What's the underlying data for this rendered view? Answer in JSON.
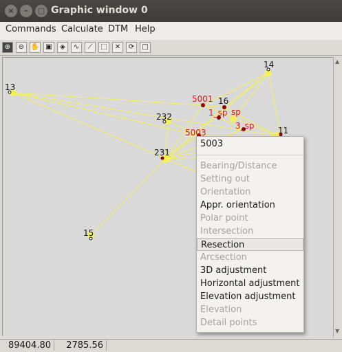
{
  "window": {
    "title": "Graphic window 0",
    "close": "×",
    "minimize": "–",
    "maximize": "□"
  },
  "menubar": [
    "Commands",
    "Calculate",
    "DTM",
    "Help"
  ],
  "toolbar": [
    "zoom-in-icon",
    "zoom-out-icon",
    "pan-hand-icon",
    "zoom-window-icon",
    "zoom-all-icon",
    "line-icon",
    "measure-icon",
    "select-icon",
    "cross-icon",
    "refresh-icon",
    "frame-icon"
  ],
  "points": {
    "p13": "13",
    "p14": "14",
    "p16": "16",
    "p5001": "5001",
    "p232": "232",
    "p1sp": "1_sp",
    "psp": "sp",
    "p3sp": "3_sp",
    "p5003": "5003",
    "p11": "11",
    "p231": "231",
    "p15": "15"
  },
  "context_menu": {
    "header": "5003",
    "items": [
      {
        "label": "Bearing/Distance",
        "enabled": false
      },
      {
        "label": "Setting out",
        "enabled": false
      },
      {
        "label": "Orientation",
        "enabled": false
      },
      {
        "label": "Appr. orientation",
        "enabled": true
      },
      {
        "label": "Polar point",
        "enabled": false
      },
      {
        "label": "Intersection",
        "enabled": false
      },
      {
        "label": "Resection",
        "enabled": true,
        "hover": true
      },
      {
        "label": "Arcsection",
        "enabled": false
      },
      {
        "label": "3D adjustment",
        "enabled": true
      },
      {
        "label": "Horizontal adjustment",
        "enabled": true
      },
      {
        "label": "Elevation adjustment",
        "enabled": true
      },
      {
        "label": "Elevation",
        "enabled": false
      },
      {
        "label": "Detail points",
        "enabled": false
      }
    ]
  },
  "status": {
    "x": "89404.80",
    "y": "2785.56"
  },
  "colors": {
    "line": "#f4f05a",
    "control_label": "#d41717",
    "point_label": "#111111"
  }
}
